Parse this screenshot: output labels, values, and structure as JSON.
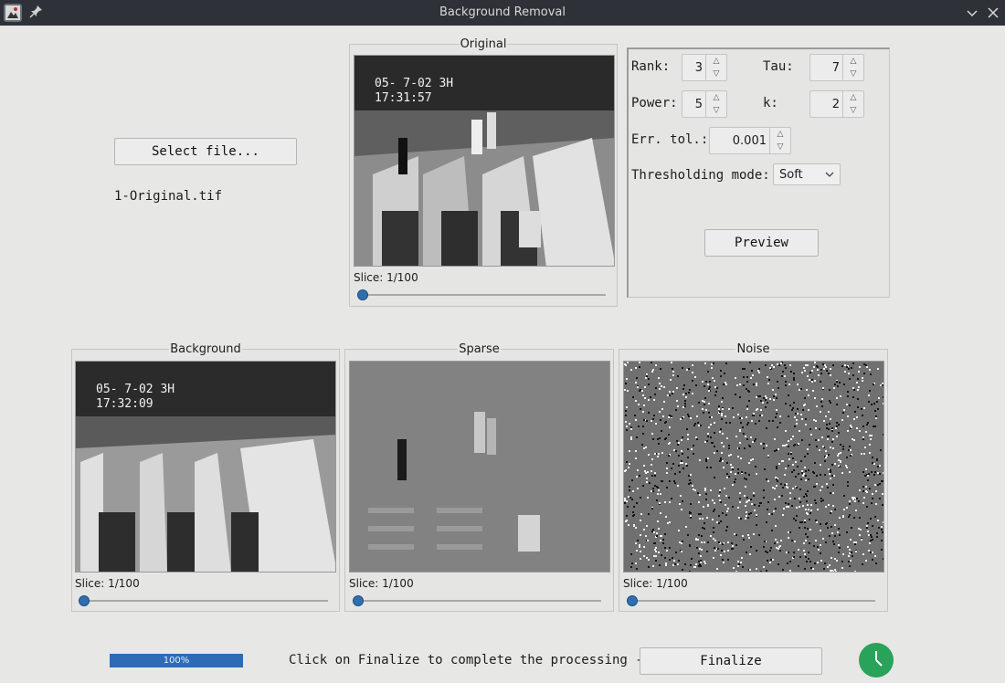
{
  "window": {
    "title": "Background Removal"
  },
  "left": {
    "select_button": "Select file...",
    "filename": "1-Original.tif"
  },
  "original": {
    "title": "Original",
    "timestamp_line1": "05- 7-02  3H",
    "timestamp_line2": "17:31:57",
    "slice": "Slice: 1/100",
    "slider_value": 0.0
  },
  "params": {
    "rank_label": "Rank:",
    "rank_value": "3",
    "tau_label": "Tau:",
    "tau_value": "7",
    "power_label": "Power:",
    "power_value": "5",
    "k_label": "k:",
    "k_value": "2",
    "err_label": "Err. tol.:",
    "err_value": "0.001",
    "threshold_label": "Thresholding mode:",
    "threshold_value": "Soft",
    "preview_button": "Preview"
  },
  "background": {
    "title": "Background",
    "timestamp_line1": "05- 7-02  3H",
    "timestamp_line2": "17:32:09",
    "slice": "Slice: 1/100",
    "slider_value": 0.0
  },
  "sparse": {
    "title": "Sparse",
    "slice": "Slice: 1/100",
    "slider_value": 0.0
  },
  "noise": {
    "title": "Noise",
    "slice": "Slice: 1/100",
    "slider_value": 0.0
  },
  "footer": {
    "progress_text": "100%",
    "progress_value": 1.0,
    "instruction": "Click on Finalize to complete the processing ->",
    "finalize_button": "Finalize"
  },
  "colors": {
    "accent": "#2f6fb0",
    "titlebar": "#2e3238",
    "status_green": "#2aa35a"
  },
  "icons": [
    "app-icon",
    "pin-icon",
    "minimize-icon",
    "close-icon",
    "clock-icon",
    "spin-up-icon",
    "spin-down-icon",
    "dropdown-arrow-icon"
  ]
}
